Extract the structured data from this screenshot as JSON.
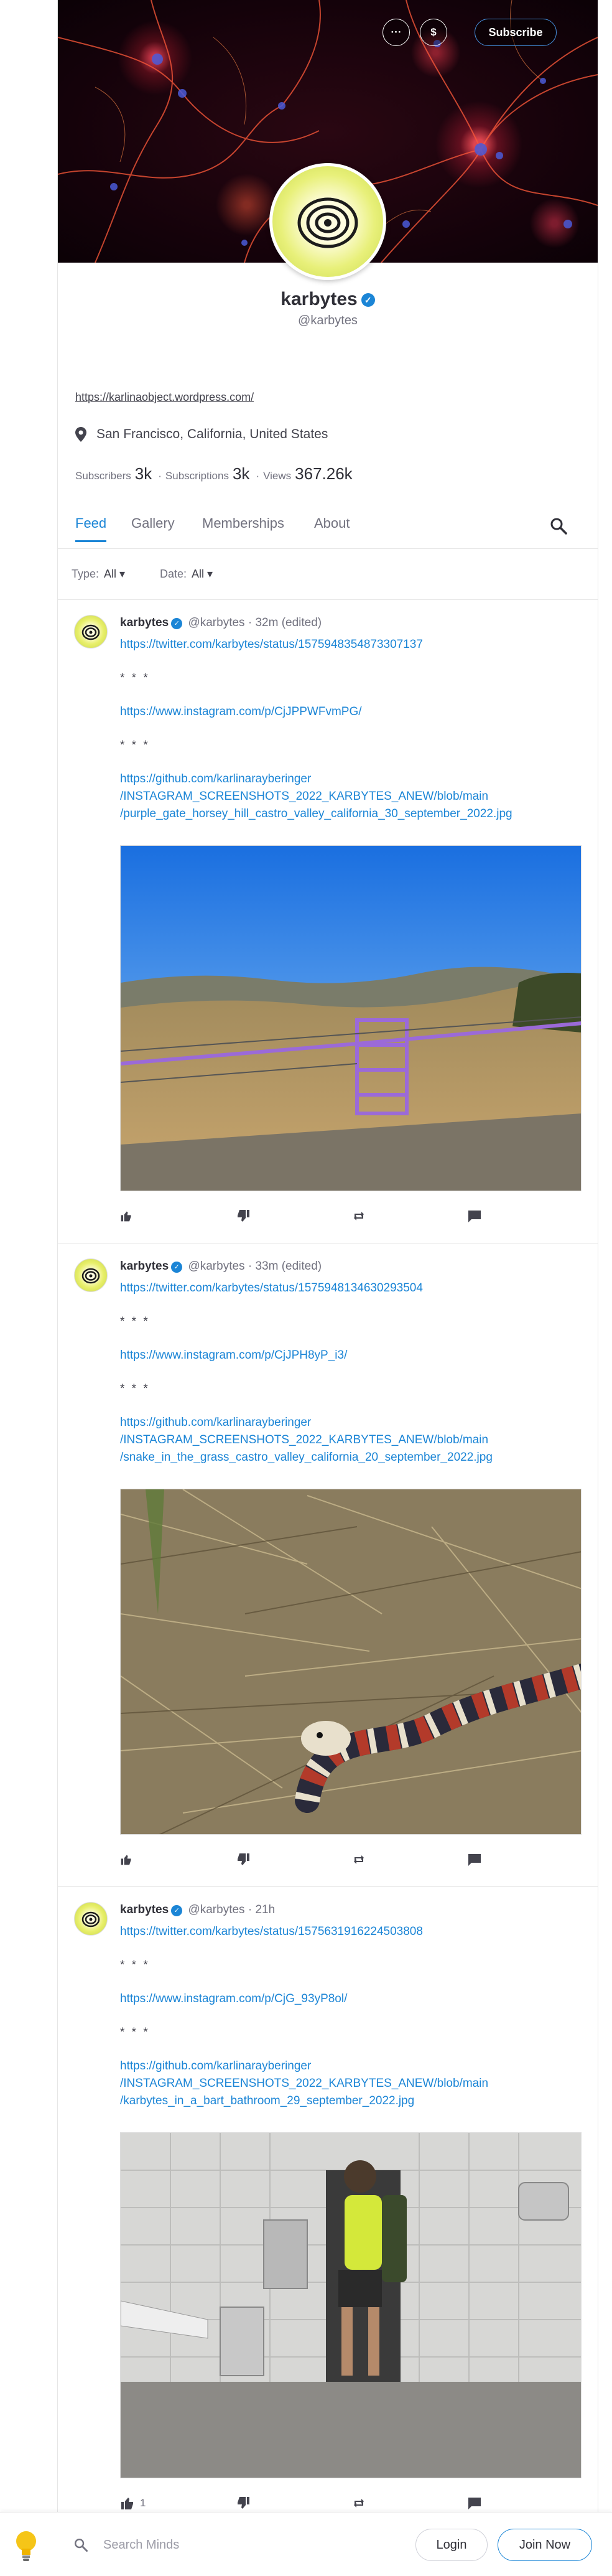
{
  "banner": {
    "more_label": "···",
    "tip_label": "$",
    "subscribe_label": "Subscribe"
  },
  "profile": {
    "name": "karbytes",
    "handle": "@karbytes",
    "website": "https://karlinaobject.wordpress.com/",
    "location": "San Francisco, California, United States",
    "stats": {
      "subscribers_label": "Subscribers",
      "subscribers": "3k",
      "subscriptions_label": "Subscriptions",
      "subscriptions": "3k",
      "views_label": "Views",
      "views": "367.26k",
      "dot": "·"
    }
  },
  "tabs": {
    "feed": "Feed",
    "gallery": "Gallery",
    "memberships": "Memberships",
    "about": "About"
  },
  "filters": {
    "type_label": "Type:",
    "type_value": "All ▾",
    "date_label": "Date:",
    "date_value": "All ▾"
  },
  "posts": [
    {
      "username": "karbytes",
      "handle": "@karbytes",
      "time": "· 32m (edited)",
      "twitter": "https://twitter.com/karbytes/status/1575948354873307137",
      "sep": "* * *",
      "instagram": "https://www.instagram.com/p/CjJPPWFvmPG/",
      "github_1": "https://github.com/karlinarayberinger",
      "github_2": "/INSTAGRAM_SCREENSHOTS_2022_KARBYTES_ANEW/blob/main",
      "github_3": "/purple_gate_horsey_hill_castro_valley_california_30_september_2022.jpg",
      "likes": ""
    },
    {
      "username": "karbytes",
      "handle": "@karbytes",
      "time": "· 33m (edited)",
      "twitter": "https://twitter.com/karbytes/status/1575948134630293504",
      "sep": "* * *",
      "instagram": "https://www.instagram.com/p/CjJPH8yP_i3/",
      "github_1": "https://github.com/karlinarayberinger",
      "github_2": "/INSTAGRAM_SCREENSHOTS_2022_KARBYTES_ANEW/blob/main",
      "github_3": "/snake_in_the_grass_castro_valley_california_20_september_2022.jpg",
      "likes": ""
    },
    {
      "username": "karbytes",
      "handle": "@karbytes",
      "time": "· 21h",
      "twitter": "https://twitter.com/karbytes/status/1575631916224503808",
      "sep": "* * *",
      "instagram": "https://www.instagram.com/p/CjG_93yP8ol/",
      "github_1": "https://github.com/karlinarayberinger",
      "github_2": "/INSTAGRAM_SCREENSHOTS_2022_KARBYTES_ANEW/blob/main",
      "github_3": "/karbytes_in_a_bart_bathroom_29_september_2022.jpg",
      "likes": "1"
    }
  ],
  "bottombar": {
    "search_placeholder": "Search Minds",
    "login_label": "Login",
    "join_label": "Join Now"
  },
  "colors": {
    "accent": "#1b85d6",
    "text": "#43434d",
    "muted": "#72727f"
  },
  "icons": [
    "more-icon",
    "dollar-icon",
    "verified-icon",
    "location-pin-icon",
    "search-icon",
    "thumb-up-icon",
    "thumb-down-icon",
    "remind-icon",
    "comment-icon",
    "lightbulb-icon"
  ]
}
